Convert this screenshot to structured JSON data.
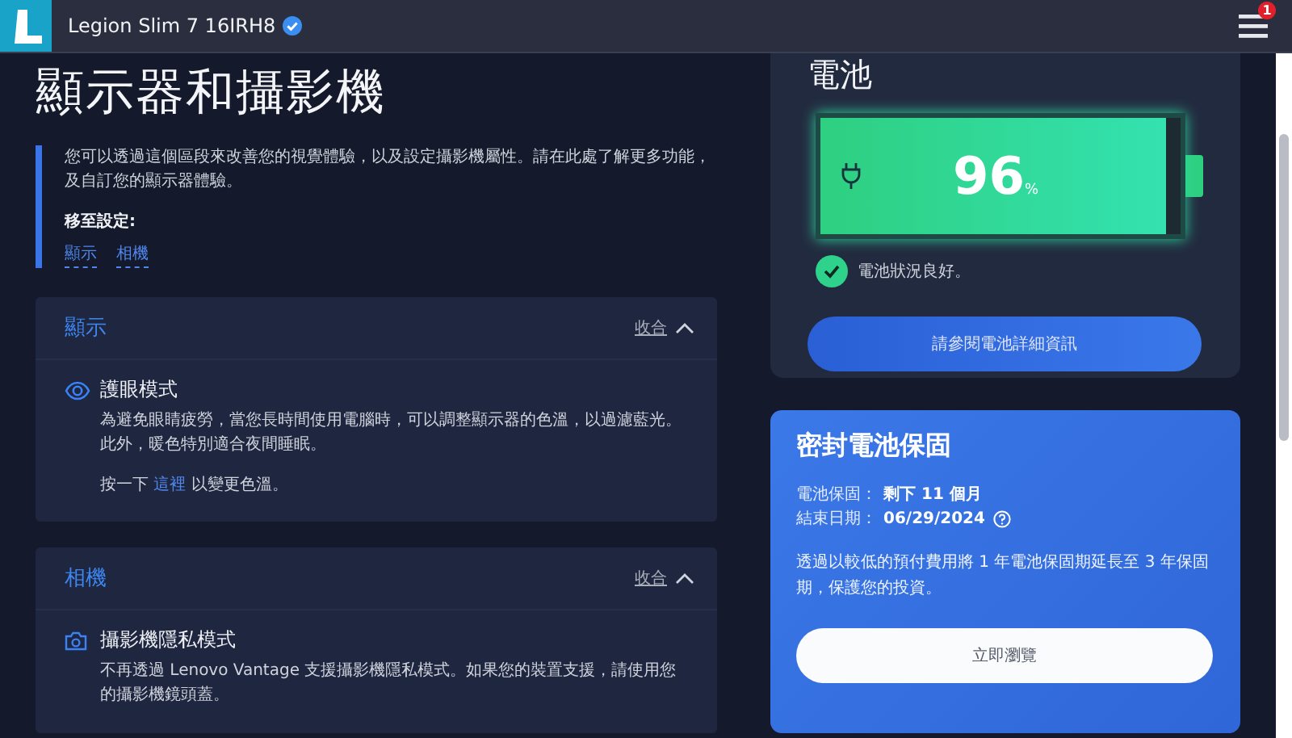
{
  "app_bar": {
    "device_name": "Legion Slim 7 16IRH8",
    "verified": true,
    "menu_badge": "1"
  },
  "page": {
    "title": "顯示器和攝影機",
    "intro": "您可以透過這個區段來改善您的視覺體驗，以及設定攝影機屬性。請在此處了解更多功能，及自訂您的顯示器體驗。",
    "jump_label": "移至設定:",
    "jump_links": [
      "顯示",
      "相機"
    ]
  },
  "sections": [
    {
      "title": "顯示",
      "collapse_label": "收合",
      "expanded": true,
      "items": [
        {
          "kind": "eye",
          "title": "護眼模式",
          "description": "為避免眼睛疲勞，當您長時間使用電腦時，可以調整顯示器的色溫，以過濾藍光。此外，暖色特別適合夜間睡眠。",
          "action": {
            "before": "按一下",
            "link": "這裡",
            "after": "以變更色溫。"
          }
        }
      ]
    },
    {
      "title": "相機",
      "collapse_label": "收合",
      "expanded": true,
      "items": [
        {
          "kind": "camera",
          "title": "攝影機隱私模式",
          "description": "不再透過 Lenovo Vantage 支援攝影機隱私模式。如果您的裝置支援，請使用您的攝影機鏡頭蓋。"
        }
      ]
    }
  ],
  "battery": {
    "title": "電池",
    "level": 0.96,
    "percent": "96",
    "unit": "%",
    "charging": true,
    "status": "電池狀況良好。",
    "status_ok": true,
    "details_button": "請參閱電池詳細資訊"
  },
  "warranty": {
    "title": "密封電池保固",
    "rows": [
      {
        "label": "電池保固：",
        "value": "剩下 11 個月",
        "help": false
      },
      {
        "label": "結束日期：",
        "value": "06/29/2024",
        "help": true
      }
    ],
    "description": "透過以較低的預付費用將 1 年電池保固期延長至 3 年保固期，保護您的投資。",
    "button": "立即瀏覽"
  }
}
